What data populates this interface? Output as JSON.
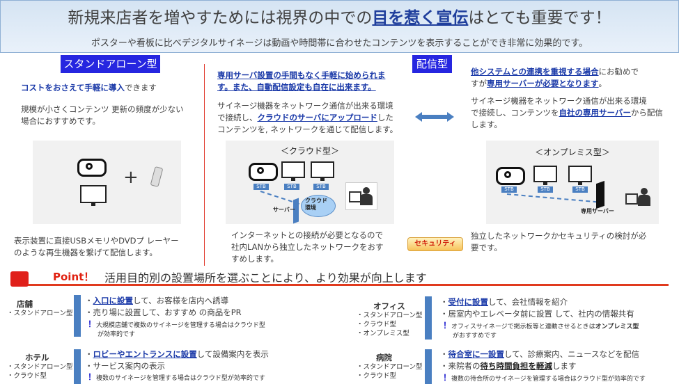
{
  "header": {
    "title_pre": "新規来店者を増やすためには視界の中での",
    "title_em": "目を惹く宣伝",
    "title_post": "はとても重要です！",
    "subtitle": "ポスターや看板に比べデジタルサイネージは動画や時間帯に合わせたコンテンツを表示することができ非常に効果的です。"
  },
  "standalone": {
    "tag": "スタンドアローン型",
    "lead": "コストをおさえて手軽に導入",
    "lead_rest": "できます",
    "desc1": "規模が小さくコンテンツ 更新の頻度が少ない",
    "desc2": "場合におすすめです。",
    "plus": "+",
    "foot1": "表示装置に直接USBメモリやDVDプ レーヤー",
    "foot2": "のような再生機器を繋げて配信します。"
  },
  "delivery": {
    "tag": "配信型"
  },
  "cloud": {
    "lead1": "専用サーバ設置の手間もなく手軽に始められま",
    "lead2": "す。また、自動配信設定も自在に出来ます。",
    "d1": "サイネージ機器をネットワーク通信が出来る環境",
    "d2a": "で接続し、",
    "d2b": "クラウドのサーバにアップロード",
    "d2c": "した",
    "d3": "コンテンツを, ネットワークを通じて配信します。",
    "diagram_title": "＜クラウド型＞",
    "stb": "STB",
    "cloud_label1": "クラウド",
    "cloud_label2": "環境",
    "server_label": "サーバー",
    "foot1": "インターネットとの接続が必要となるので",
    "foot2": "社内LANから独立したネットワークをおす",
    "foot3": "すめします。"
  },
  "security": {
    "label": "セキュリティ"
  },
  "onprem": {
    "lead1a": "他システムとの連携を重視する場合",
    "lead1b": "にお勧めで",
    "lead2a": "すが",
    "lead2b": "専用サーバーが必要となります",
    "lead2c": "。",
    "d1": "サイネージ機器をネットワーク通信が出来る環境",
    "d2a": "で接続し、コンテンツを",
    "d2b": "自社の専用サーバー",
    "d2c": "から配信",
    "d3": "します。",
    "diagram_title": "＜オンプレミス型＞",
    "stb": "STB",
    "server_label": "専用サーバー",
    "foot1": "独立したネットワークかセキュリティの検討が必",
    "foot2": "要です。"
  },
  "point": {
    "label": "Point！",
    "text": "活用目的別の設置場所を選ぶことにより、より効果が向上します"
  },
  "uses": {
    "store": {
      "name": "店舗",
      "types": "・スタンドアローン型",
      "l1a": "・",
      "l1b": "入口に設置",
      "l1c": "して、お客様を店内へ誘導",
      "l2": "・売り場に設置して、おすすめ の商品をPR",
      "note1": "大規模店舗で複数のサイネージを管理する場合はクラウド型",
      "note2": "が効率的です"
    },
    "hotel": {
      "name": "ホテル",
      "types1": "・スタンドアローン型",
      "types2": "・クラウド型",
      "l1a": "・",
      "l1b": "ロビーやエントランスに設置",
      "l1c": "して設備案内を表示",
      "l2": "・サービス案内の表示",
      "note1": "複数のサイネージを管理する場合はクラウド型が効率的です"
    },
    "office": {
      "name": "オフィス",
      "types1": "・スタンドアローン型",
      "types2": "・クラウド型",
      "types3": "・オンプレミス型",
      "l1a": "・",
      "l1b": "受付に設置",
      "l1c": "して、会社情報を紹介",
      "l2": "・居室内やエレベータ前に設置 して、社内の情報共有",
      "note1a": "オフィスサイネージで掲示板等と連動させるときは",
      "note1b": "オンプレミス型",
      "note2": "がおすすめです"
    },
    "hospital": {
      "name": "病院",
      "types1": "・スタンドアローン型",
      "types2": "・クラウド型",
      "l1a": "・",
      "l1b": "待合室に一設置",
      "l1c": "して、診療案内、ニュースなどを配信",
      "l2a": "・来院者の",
      "l2b": "待ち時間負担を軽減",
      "l2c": "します",
      "note1": "複数の待合所のサイネージを管理する場合はクラウド型が効率的です"
    }
  },
  "colors": {
    "accent_blue": "#1a39a8",
    "tag_blue": "#2626e0",
    "red": "#e0201a",
    "bar_blue": "#4a7fc1"
  }
}
